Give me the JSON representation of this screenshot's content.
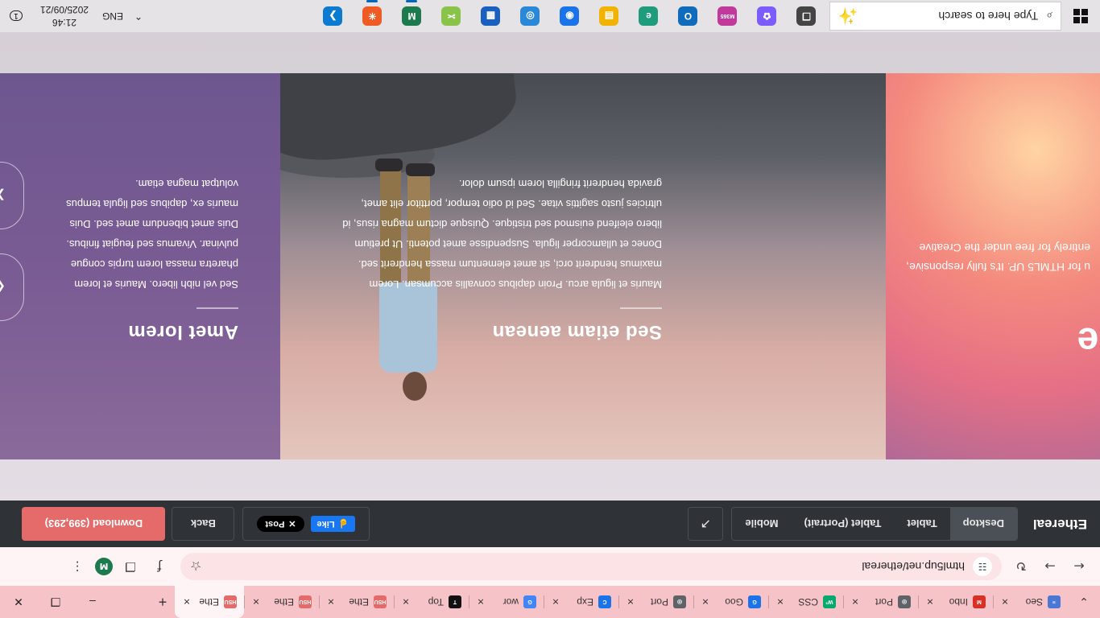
{
  "browser": {
    "tabs": [
      {
        "favicon": "chrome-icon",
        "fav_color": "#1a73e8",
        "fav_text": "G",
        "title": "Goo"
      },
      {
        "favicon": "globe-icon",
        "fav_color": "#5f6368",
        "fav_text": "◎",
        "title": "Port"
      },
      {
        "favicon": "chrome-dev-icon",
        "fav_color": "#1a73e8",
        "fav_text": "C",
        "title": "Exp"
      },
      {
        "favicon": "google-icon",
        "fav_color": "#4285f4",
        "fav_text": "G",
        "title": "wor"
      },
      {
        "favicon": "toptal-icon",
        "fav_color": "#111111",
        "fav_text": "T",
        "title": "Top"
      },
      {
        "favicon": "html5up-icon",
        "fav_color": "#e56a6a",
        "fav_text": "HSU",
        "title": "Ethe"
      },
      {
        "favicon": "html5up-icon",
        "fav_color": "#e56a6a",
        "fav_text": "HSU",
        "title": "Ethe"
      },
      {
        "favicon": "html5up-icon",
        "fav_color": "#e56a6a",
        "fav_text": "HSU",
        "title": "Ethe"
      }
    ],
    "leading_tabs": [
      {
        "favicon": "doc-icon",
        "fav_color": "#4a78d4",
        "fav_text": "≡",
        "title": "Seo"
      },
      {
        "favicon": "gmail-icon",
        "fav_color": "#d93025",
        "fav_text": "M",
        "title": "Inbo"
      },
      {
        "favicon": "globe-icon",
        "fav_color": "#5f6368",
        "fav_text": "◎",
        "title": "Port"
      },
      {
        "favicon": "w3schools-icon",
        "fav_color": "#04aa6d",
        "fav_text": "W³",
        "title": "CSS"
      }
    ],
    "new_tab_label": "+",
    "url": "html5up.net/ethereal",
    "avatar_letter": "M"
  },
  "preview_bar": {
    "template_name": "Ethereal",
    "devices": [
      {
        "label": "Desktop",
        "active": true
      },
      {
        "label": "Tablet",
        "active": false
      },
      {
        "label": "Tablet (Portrait)",
        "active": false
      },
      {
        "label": "Mobile",
        "active": false
      }
    ],
    "like_label": "Like",
    "post_label": "Post",
    "back_label": "Back",
    "download_label": "Download (399,293)"
  },
  "page": {
    "intro": {
      "heading": "me",
      "text_lines": [
        "u for HTML5 UP. It's fully responsive,",
        "entirely for free under the Creative"
      ]
    },
    "panel_photo": {
      "title": "Sed etiam aenean",
      "body_lines": [
        "Mauris et ligula arcu. Proin dapibus convallis accumsan. Lorem",
        "maximus hendrerit orci, sit amet elementum massa hendrerit sed.",
        "Donec et ullamcorper ligula. Suspendisse amet potenti. Ut pretium",
        "libero eleifend euismod sed tristique. Quisque dictum magna risus, id",
        "ultricies justo sagittis vitae. Sed id odio tempor, porttitor elit amet,",
        "gravida hendrerit fringilla lorem ipsum dolor."
      ]
    },
    "panel_amet": {
      "title": "Amet lorem",
      "body_lines": [
        "Sed vel nibh libero. Mauris et lorem",
        "pharetra massa lorem turpis congue",
        "pulvinar. Vivamus sed feugiat finibus.",
        "Duis amet bibendum amet sed. Duis",
        "mauris ex, dapibus sed ligula tempus",
        "volutpat magna etiam."
      ]
    }
  },
  "taskbar": {
    "search_placeholder": "Type here to search",
    "apps": [
      {
        "name": "task-view-icon",
        "color": "#444444",
        "text": "❒",
        "running": false
      },
      {
        "name": "copilot-icon",
        "color": "#7b5cff",
        "text": "✿",
        "running": false
      },
      {
        "name": "m365-icon",
        "color": "#c2399c",
        "text": "M365",
        "running": false
      },
      {
        "name": "outlook-icon",
        "color": "#0f6cbd",
        "text": "O",
        "running": false
      },
      {
        "name": "edge-icon",
        "color": "#1f9c7c",
        "text": "e",
        "running": false
      },
      {
        "name": "file-explorer-icon",
        "color": "#f2b300",
        "text": "▤",
        "running": false
      },
      {
        "name": "chrome-icon",
        "color": "#1a73e8",
        "text": "◉",
        "running": false
      },
      {
        "name": "chrome-canary-icon",
        "color": "#2b88d8",
        "text": "◎",
        "running": false
      },
      {
        "name": "microsoft-store-icon",
        "color": "#1b5fbf",
        "text": "▦",
        "running": false
      },
      {
        "name": "snipping-icon",
        "color": "#8ac34a",
        "text": "✂",
        "running": false
      },
      {
        "name": "chrome-profile-icon",
        "color": "#1c7a4e",
        "text": "M",
        "running": true
      },
      {
        "name": "postman-icon",
        "color": "#ef5b25",
        "text": "✳",
        "running": true
      },
      {
        "name": "vscode-icon",
        "color": "#0b7ad1",
        "text": "❯",
        "running": false
      }
    ],
    "language": "ENG",
    "time": "21:46",
    "date": "2025/09/21",
    "notification_count": "1"
  }
}
